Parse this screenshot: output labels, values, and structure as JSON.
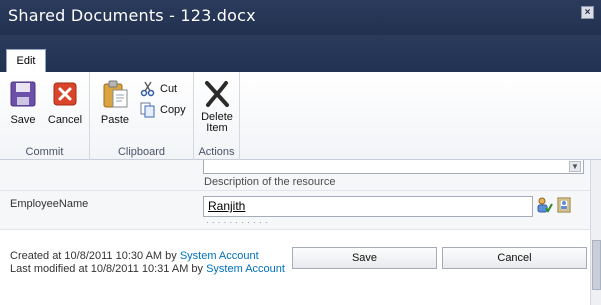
{
  "window": {
    "title": "Shared Documents - 123.docx",
    "close_glyph": "×"
  },
  "tabs": {
    "edit_label": "Edit"
  },
  "ribbon": {
    "commit": {
      "label": "Commit",
      "save": "Save",
      "cancel": "Cancel"
    },
    "clipboard": {
      "label": "Clipboard",
      "paste": "Paste",
      "cut": "Cut",
      "copy": "Copy"
    },
    "actions": {
      "label": "Actions",
      "delete_line1": "Delete",
      "delete_line2": "Item"
    }
  },
  "form": {
    "description_text": "Description of the resource",
    "employee_label": "EmployeeName",
    "employee_value": "Ranjith",
    "hint_fragment": "· · · · · · · · · · ·"
  },
  "footer": {
    "created_prefix": "Created at 10/8/2011 10:30 AM  by ",
    "created_by": "System Account",
    "modified_prefix": "Last modified at 10/8/2011 10:31 AM  by ",
    "modified_by": "System Account",
    "save_button": "Save",
    "cancel_button": "Cancel"
  },
  "colors": {
    "titlebar": "#1f2d4a",
    "link": "#0072bc",
    "accent_red": "#d9452b"
  }
}
